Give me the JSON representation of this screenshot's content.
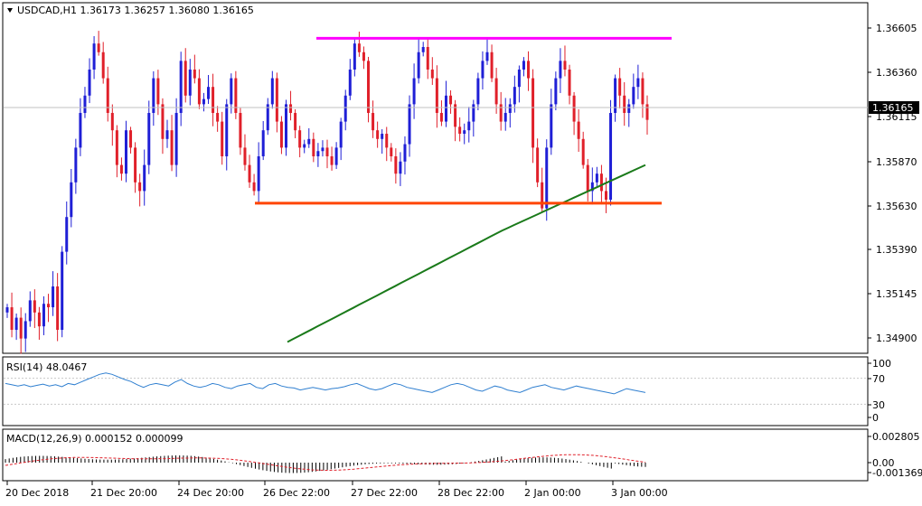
{
  "symbol_header": "USDCAD,H1  1.36173  1.36257  1.36080  1.36165",
  "price_axis": {
    "ticks": [
      "1.36605",
      "1.36360",
      "1.36115",
      "1.35870",
      "1.35630",
      "1.35390",
      "1.35145",
      "1.34900"
    ],
    "current_price": "1.36165"
  },
  "time_axis": {
    "labels": [
      "20 Dec 2018",
      "21 Dec 20:00",
      "24 Dec 20:00",
      "26 Dec 22:00",
      "27 Dec 22:00",
      "28 Dec 22:00",
      "2 Jan 00:00",
      "3 Jan 00:00"
    ]
  },
  "rsi_panel": {
    "label": "RSI(14) 48.0467",
    "ticks": [
      "100",
      "70",
      "30",
      "0"
    ]
  },
  "macd_panel": {
    "label": "MACD(12,26,9) 0.000152 0.000099",
    "ticks": [
      "0.002805",
      "0.00",
      "-0.001369"
    ]
  },
  "colors": {
    "bull": "#1f1fd6",
    "bear": "#e0202a",
    "resistance": "#ff00ff",
    "support": "#ff4500",
    "ma": "#1a7a1a",
    "rsi": "#2f7fd0",
    "signal": "#e0202a"
  },
  "chart_data": [
    {
      "type": "candlestick",
      "title": "USDCAD,H1",
      "ohlc_last": {
        "open": 1.36173,
        "high": 1.36257,
        "low": 1.3608,
        "close": 1.36165
      },
      "ylim": [
        1.3482,
        1.3683
      ],
      "x_labels": [
        "20 Dec 2018",
        "21 Dec 20:00",
        "24 Dec 20:00",
        "26 Dec 22:00",
        "27 Dec 22:00",
        "28 Dec 22:00",
        "2 Jan 00:00",
        "3 Jan 00:00"
      ],
      "closes": [
        1.3508,
        1.3495,
        1.3502,
        1.349,
        1.35,
        1.3512,
        1.3505,
        1.3497,
        1.351,
        1.3508,
        1.352,
        1.3495,
        1.354,
        1.356,
        1.358,
        1.36,
        1.362,
        1.363,
        1.3645,
        1.366,
        1.3655,
        1.364,
        1.362,
        1.361,
        1.359,
        1.3585,
        1.361,
        1.36,
        1.358,
        1.3575,
        1.359,
        1.362,
        1.364,
        1.3625,
        1.3605,
        1.361,
        1.359,
        1.362,
        1.365,
        1.363,
        1.3645,
        1.364,
        1.3625,
        1.3628,
        1.3635,
        1.362,
        1.3615,
        1.3595,
        1.3625,
        1.364,
        1.362,
        1.36,
        1.359,
        1.358,
        1.3575,
        1.3595,
        1.361,
        1.3625,
        1.364,
        1.3615,
        1.36,
        1.3625,
        1.362,
        1.361,
        1.36,
        1.3602,
        1.3605,
        1.3595,
        1.3598,
        1.36,
        1.3595,
        1.359,
        1.36,
        1.3615,
        1.363,
        1.3645,
        1.366,
        1.3655,
        1.365,
        1.362,
        1.361,
        1.3605,
        1.3608,
        1.36,
        1.3595,
        1.3585,
        1.3592,
        1.3602,
        1.3625,
        1.364,
        1.3655,
        1.3658,
        1.3645,
        1.364,
        1.362,
        1.3615,
        1.363,
        1.3625,
        1.3612,
        1.3608,
        1.361,
        1.3615,
        1.3625,
        1.364,
        1.365,
        1.3655,
        1.364,
        1.3625,
        1.3615,
        1.362,
        1.3625,
        1.3635,
        1.3645,
        1.365,
        1.364,
        1.36,
        1.358,
        1.3565,
        1.36,
        1.3625,
        1.364,
        1.365,
        1.3645,
        1.363,
        1.3615,
        1.3605,
        1.359,
        1.3575,
        1.358,
        1.3585,
        1.3575,
        1.357,
        1.362,
        1.364,
        1.363,
        1.362,
        1.3625,
        1.3635,
        1.364,
        1.3625,
        1.3616
      ],
      "ma_200": {
        "start": 1.3488,
        "end": 1.359
      },
      "resistance_level": 1.3663,
      "support_level": 1.3568
    },
    {
      "type": "line",
      "title": "RSI(14) 48.0467",
      "ylim": [
        0,
        100
      ],
      "levels": [
        30,
        70
      ],
      "values": [
        62,
        60,
        58,
        60,
        57,
        59,
        61,
        58,
        60,
        57,
        62,
        60,
        64,
        68,
        72,
        76,
        78,
        76,
        72,
        68,
        65,
        60,
        56,
        60,
        62,
        60,
        58,
        64,
        68,
        62,
        58,
        56,
        58,
        62,
        60,
        56,
        54,
        58,
        60,
        62,
        56,
        54,
        60,
        62,
        58,
        56,
        55,
        52,
        54,
        56,
        54,
        52,
        54,
        55,
        57,
        60,
        62,
        58,
        54,
        52,
        54,
        58,
        62,
        60,
        56,
        54,
        52,
        50,
        48,
        52,
        56,
        60,
        62,
        60,
        56,
        52,
        50,
        54,
        58,
        56,
        52,
        50,
        48,
        52,
        56,
        58,
        60,
        56,
        54,
        52,
        55,
        58,
        56,
        54,
        52,
        50,
        48,
        46,
        50,
        54,
        52,
        50,
        48
      ],
      "last": 48.0467
    },
    {
      "type": "bar",
      "title": "MACD(12,26,9)",
      "ylim": [
        -0.001369,
        0.002805
      ],
      "macd_last": 0.000152,
      "signal_last": 9.9e-05
    }
  ]
}
